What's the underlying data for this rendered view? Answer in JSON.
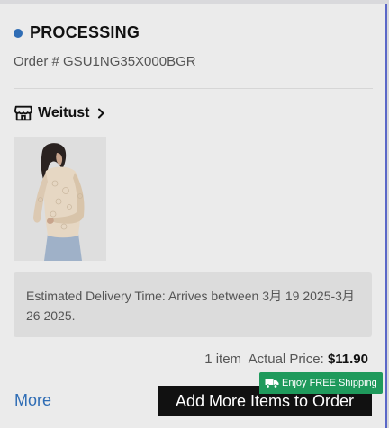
{
  "order": {
    "status": "PROCESSING",
    "status_color": "#2f6db5",
    "number_text": "Order # GSU1NG35X000BGR"
  },
  "store": {
    "icon": "store-icon",
    "name": "Weitust"
  },
  "product": {
    "image": "lace-top-photo"
  },
  "delivery": {
    "text": "Estimated Delivery Time: Arrives between 3月 19 2025-3月 26 2025."
  },
  "summary": {
    "item_count": "1 item",
    "price_label": "Actual Price:",
    "price_value": "$11.90"
  },
  "actions": {
    "more_label": "More",
    "badge_text": "Enjoy FREE Shipping",
    "badge_color": "#1f9a5c",
    "add_items_label": "Add More Items to Order"
  }
}
